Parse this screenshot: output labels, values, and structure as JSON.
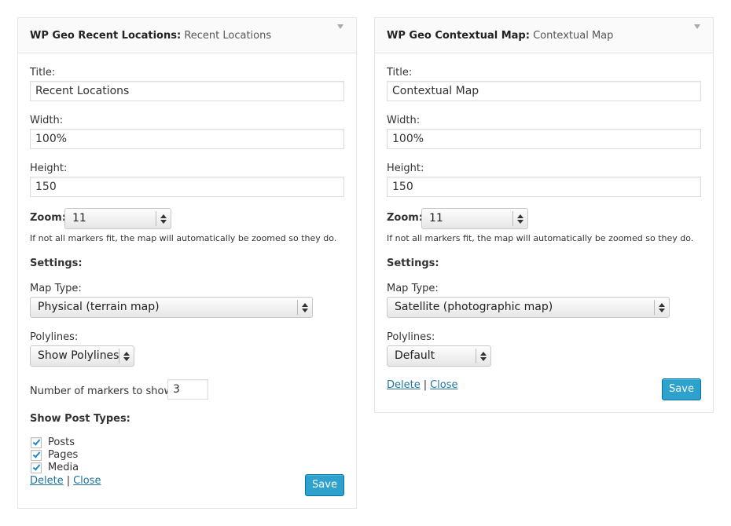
{
  "widgets": [
    {
      "name": "WP Geo Recent Locations:",
      "in_title": "Recent Locations",
      "title_label": "Title:",
      "title_value": "Recent Locations",
      "width_label": "Width:",
      "width_value": "100%",
      "height_label": "Height:",
      "height_value": "150",
      "zoom_label": "Zoom:",
      "zoom_value": "11",
      "zoom_hint": "If not all markers fit, the map will automatically be zoomed so they do.",
      "settings_label": "Settings:",
      "map_type_label": "Map Type:",
      "map_type_value": "Physical (terrain map)",
      "polylines_label": "Polylines:",
      "polylines_value": "Show Polylines",
      "markers_label": "Number of markers to show:",
      "markers_value": "3",
      "post_types_label": "Show Post Types:",
      "post_types": [
        {
          "label": "Posts",
          "checked": true
        },
        {
          "label": "Pages",
          "checked": true
        },
        {
          "label": "Media",
          "checked": true
        }
      ],
      "delete_label": "Delete",
      "separator": "|",
      "close_label": "Close",
      "save_label": "Save"
    },
    {
      "name": "WP Geo Contextual Map:",
      "in_title": "Contextual Map",
      "title_label": "Title:",
      "title_value": "Contextual Map",
      "width_label": "Width:",
      "width_value": "100%",
      "height_label": "Height:",
      "height_value": "150",
      "zoom_label": "Zoom:",
      "zoom_value": "11",
      "zoom_hint": "If not all markers fit, the map will automatically be zoomed so they do.",
      "settings_label": "Settings:",
      "map_type_label": "Map Type:",
      "map_type_value": "Satellite (photographic map)",
      "polylines_label": "Polylines:",
      "polylines_value": "Default",
      "delete_label": "Delete",
      "separator": "|",
      "close_label": "Close",
      "save_label": "Save"
    }
  ],
  "colors": {
    "link": "#21759b",
    "save_button": "#2ea2cc",
    "checkmark": "#1e8cbe"
  }
}
